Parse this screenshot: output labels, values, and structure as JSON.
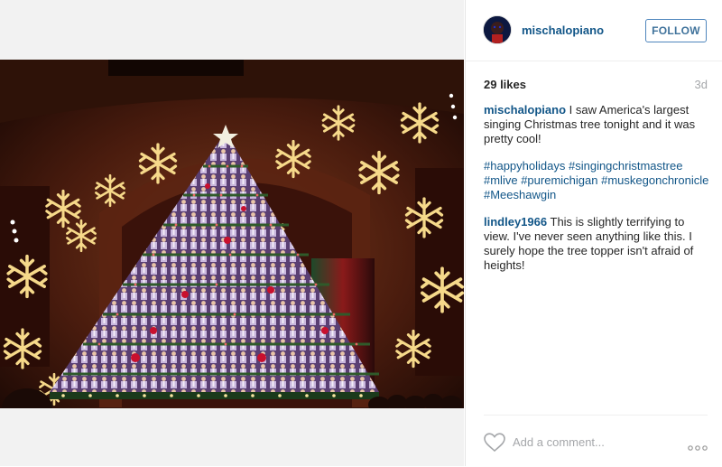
{
  "post": {
    "username": "mischalopiano",
    "follow_label": "FOLLOW",
    "likes": "29 likes",
    "time": "3d"
  },
  "comments": [
    {
      "user": "mischalopiano",
      "text": "I saw America's largest singing Christmas tree tonight and it was pretty cool!",
      "hashtags": [
        "#happyholidays",
        "#singingchristmastree",
        "#mlive",
        "#puremichigan",
        "#muskegonchronicle",
        "#Meeshawgin"
      ]
    },
    {
      "user": "lindley1966",
      "text": "This is slightly terrifying to view. I've never seen anything like this. I surely hope the tree topper isn't afraid of heights!"
    }
  ],
  "comment_box": {
    "placeholder": "Add a comment..."
  },
  "icons": {
    "like": "heart-outline-icon",
    "more": "more-options-icon"
  },
  "colors": {
    "link": "#125688",
    "follow_border": "#4f86bd",
    "muted": "#a5a7aa"
  }
}
